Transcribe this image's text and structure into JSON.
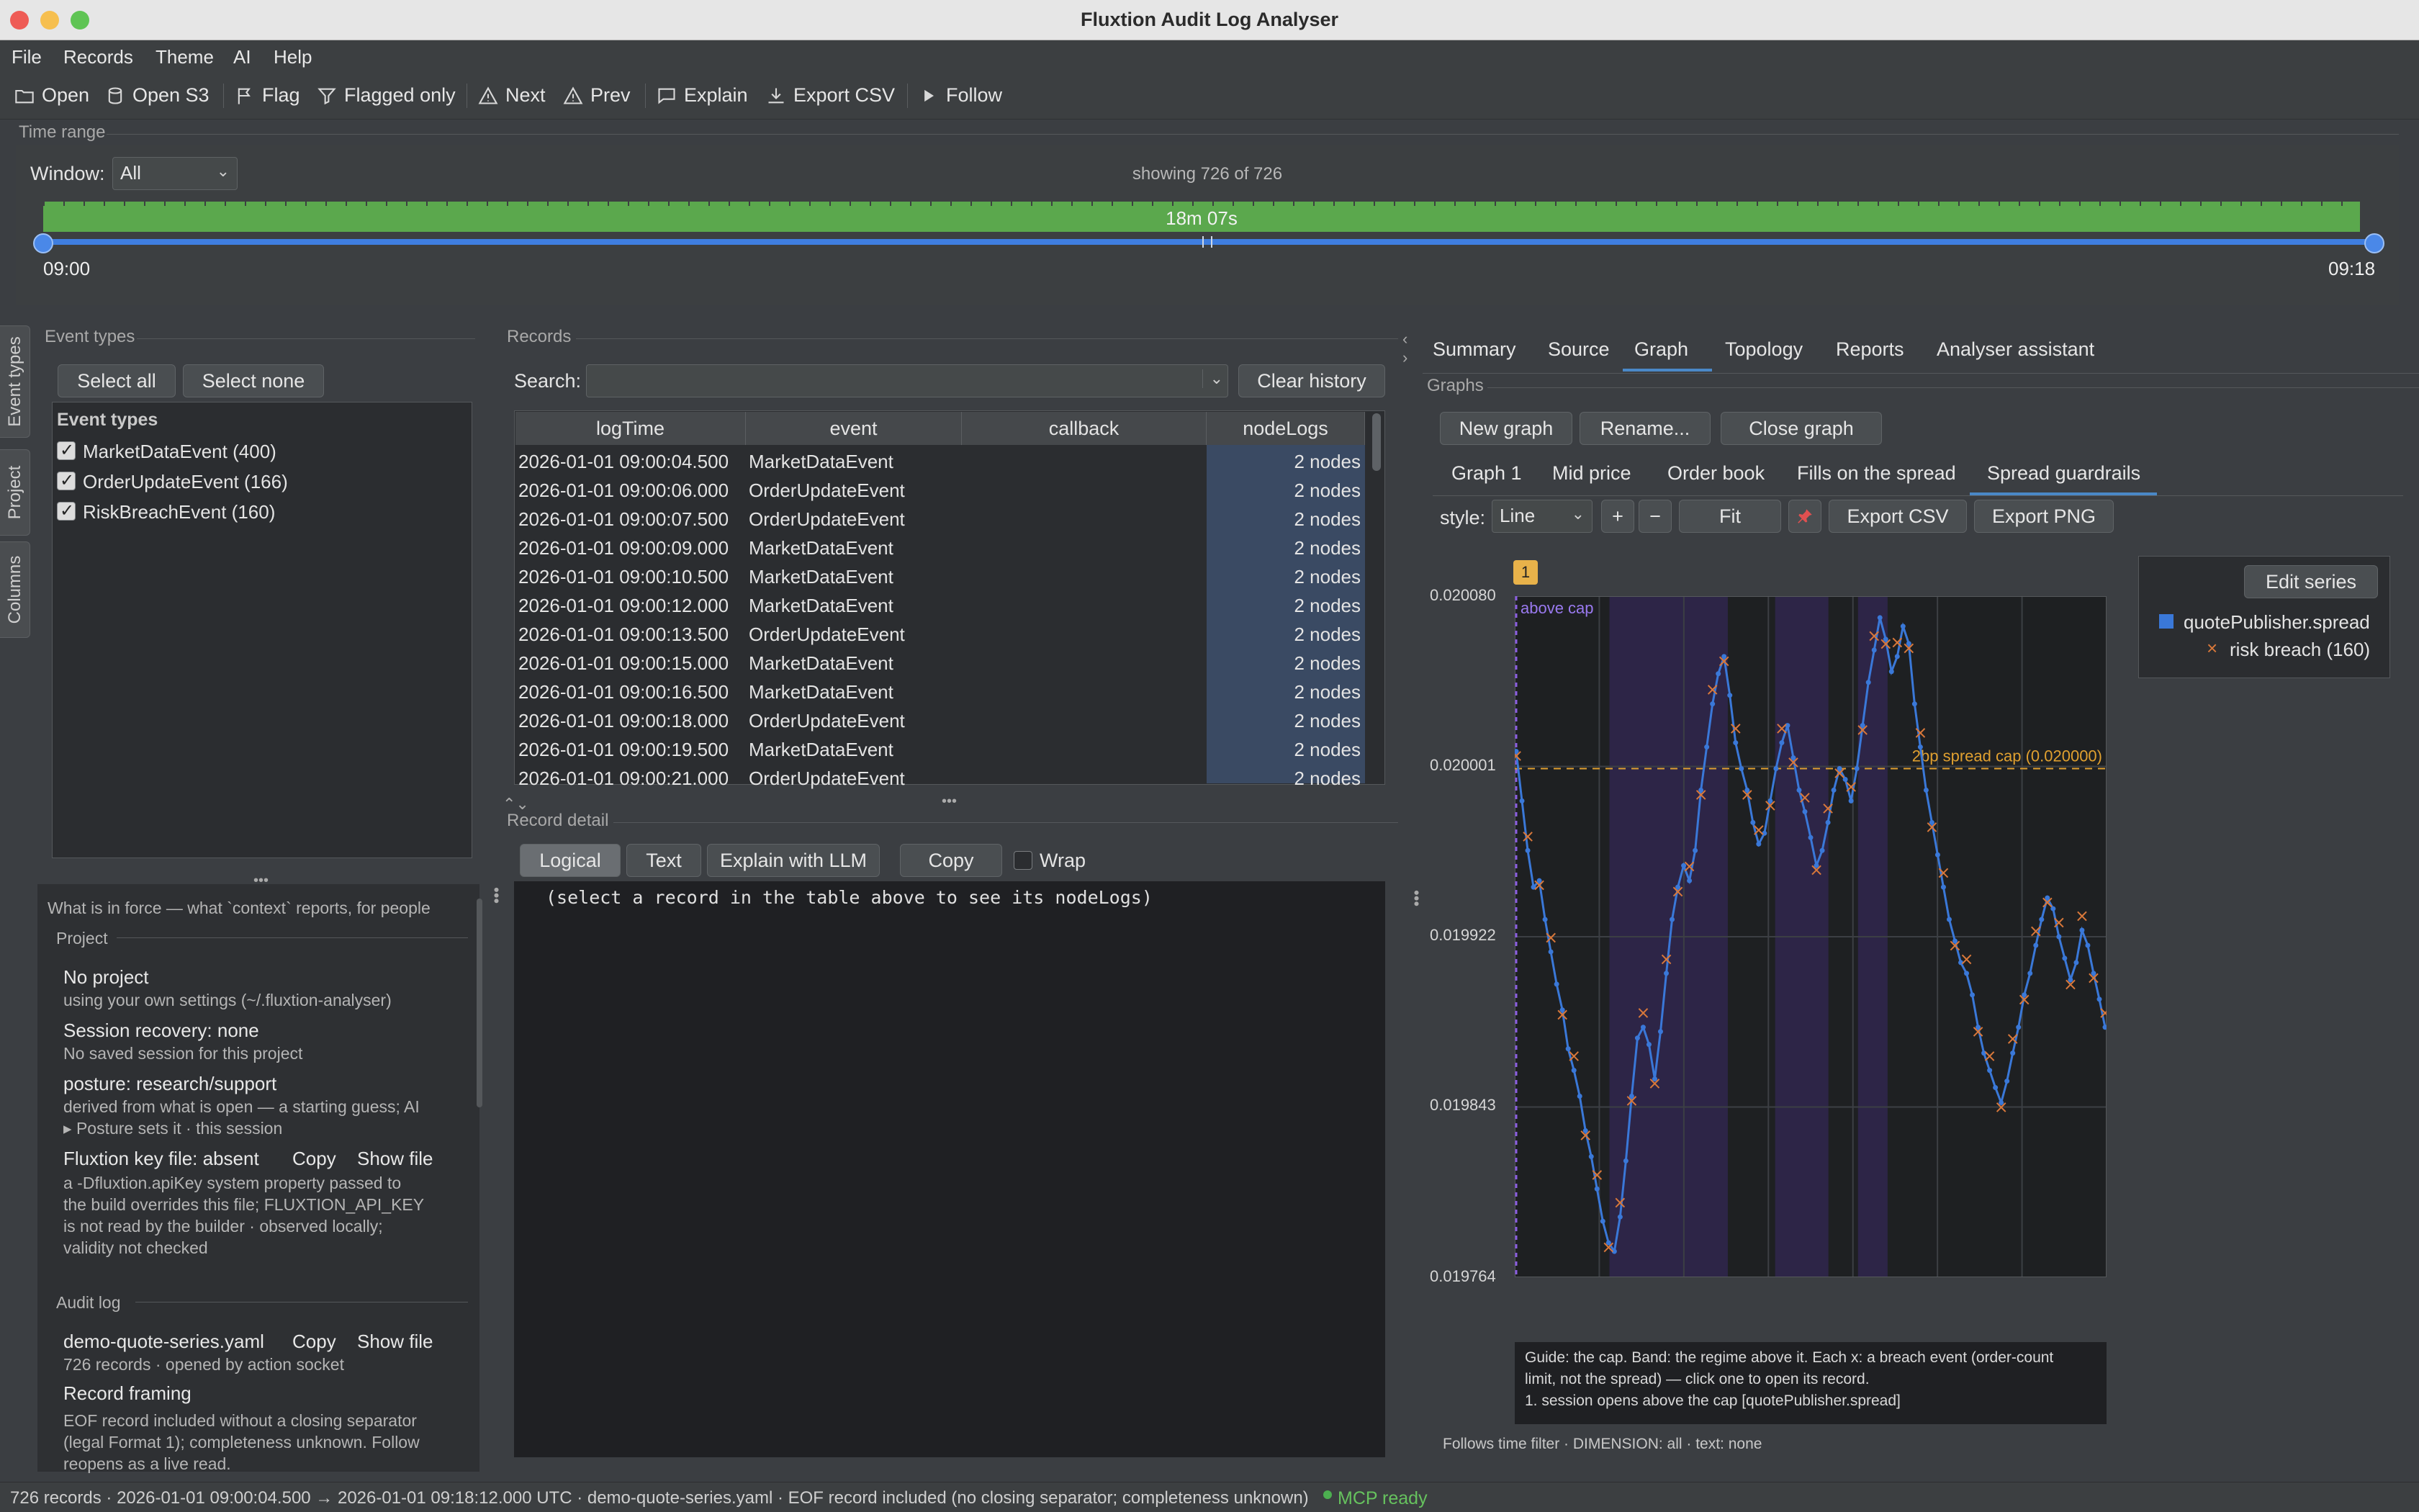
{
  "window": {
    "title": "Fluxtion Audit Log Analyser"
  },
  "menu": [
    "File",
    "Records",
    "Theme",
    "AI",
    "Help"
  ],
  "toolbar": {
    "open": "Open",
    "open_s3": "Open S3",
    "flag": "Flag",
    "flagged_only": "Flagged only",
    "next": "Next",
    "prev": "Prev",
    "explain": "Explain",
    "export_csv": "Export CSV",
    "follow": "Follow"
  },
  "time_range": {
    "group_label": "Time range",
    "window_label": "Window:",
    "window_value": "All",
    "showing": "showing 726 of 726",
    "duration": "18m 07s",
    "start": "09:00",
    "end": "09:18",
    "fill_fraction": 1.0
  },
  "rail": [
    "Event types",
    "Project",
    "Columns"
  ],
  "event_types": {
    "group_label": "Event types",
    "select_all": "Select all",
    "select_none": "Select none",
    "list_title": "Event types",
    "items": [
      {
        "name": "MarketDataEvent",
        "count": "(400)",
        "checked": true
      },
      {
        "name": "OrderUpdateEvent",
        "count": "(166)",
        "checked": true
      },
      {
        "name": "RiskBreachEvent",
        "count": "(160)",
        "checked": true
      }
    ]
  },
  "context": {
    "intro": "What is in force — what `context` reports, for people",
    "project_label": "Project",
    "no_project": "No project",
    "own_settings": "using your own settings (~/.fluxtion-analyser)",
    "session_recovery": "Session recovery: none",
    "no_saved": "No saved session for this project",
    "posture": "posture: research/support",
    "posture_note": "derived from what is open — a starting guess; AI",
    "posture_sets": "Posture sets it  ·  this session",
    "key_file": "Fluxtion key file: absent",
    "copy": "Copy",
    "show_file": "Show file",
    "key_note_1": "a -Dfluxtion.apiKey system property passed to",
    "key_note_2": "the build overrides this file; FLUXTION_API_KEY",
    "key_note_3": "is not read by the builder  ·  observed locally;",
    "key_note_4": "validity not checked",
    "audit_label": "Audit log",
    "audit_file": "demo-quote-series.yaml",
    "audit_info": "726 records  ·  opened by action socket",
    "framing": "Record framing",
    "framing_1": "EOF record included without a closing separator",
    "framing_2": "(legal Format 1); completeness unknown. Follow",
    "framing_3": "reopens as a live read."
  },
  "records": {
    "group_label": "Records",
    "search_label": "Search:",
    "search_value": "",
    "clear_history": "Clear history",
    "columns": [
      "logTime",
      "event",
      "callback",
      "nodeLogs"
    ],
    "rows": [
      [
        "2026-01-01 09:00:04.500",
        "MarketDataEvent",
        "",
        "2 nodes"
      ],
      [
        "2026-01-01 09:00:06.000",
        "OrderUpdateEvent",
        "",
        "2 nodes"
      ],
      [
        "2026-01-01 09:00:07.500",
        "OrderUpdateEvent",
        "",
        "2 nodes"
      ],
      [
        "2026-01-01 09:00:09.000",
        "MarketDataEvent",
        "",
        "2 nodes"
      ],
      [
        "2026-01-01 09:00:10.500",
        "MarketDataEvent",
        "",
        "2 nodes"
      ],
      [
        "2026-01-01 09:00:12.000",
        "MarketDataEvent",
        "",
        "2 nodes"
      ],
      [
        "2026-01-01 09:00:13.500",
        "OrderUpdateEvent",
        "",
        "2 nodes"
      ],
      [
        "2026-01-01 09:00:15.000",
        "MarketDataEvent",
        "",
        "2 nodes"
      ],
      [
        "2026-01-01 09:00:16.500",
        "MarketDataEvent",
        "",
        "2 nodes"
      ],
      [
        "2026-01-01 09:00:18.000",
        "OrderUpdateEvent",
        "",
        "2 nodes"
      ],
      [
        "2026-01-01 09:00:19.500",
        "MarketDataEvent",
        "",
        "2 nodes"
      ],
      [
        "2026-01-01 09:00:21.000",
        "OrderUpdateEvent",
        "",
        "2 nodes"
      ]
    ]
  },
  "record_detail": {
    "group_label": "Record detail",
    "logical": "Logical",
    "text": "Text",
    "explain_llm": "Explain with LLM",
    "copy": "Copy",
    "wrap": "Wrap",
    "placeholder": "(select a record in the table above to see its nodeLogs)"
  },
  "right_tabs": [
    "Summary",
    "Source",
    "Graph",
    "Topology",
    "Reports",
    "Analyser assistant"
  ],
  "right_tabs_active": "Graph",
  "graphs": {
    "group_label": "Graphs",
    "new_graph": "New graph",
    "rename": "Rename...",
    "close_graph": "Close graph",
    "tabs": [
      "Graph 1",
      "Mid price",
      "Order book",
      "Fills on the spread",
      "Spread guardrails"
    ],
    "active_tab": "Spread guardrails",
    "style_label": "style:",
    "style_value": "Line",
    "plus": "+",
    "minus": "−",
    "fit": "Fit",
    "export_csv": "Export CSV",
    "export_png": "Export PNG",
    "marker_badge": "1",
    "edit_series": "Edit series",
    "guide_1": "Guide: the cap. Band: the regime above it. Each x: a breach event (order-count",
    "guide_2": "limit, not the spread) — click one to open its record.",
    "guide_3": "1. session opens above the cap  [quotePublisher.spread]",
    "follows": "Follows time filter · DIMENSION: all · text: none"
  },
  "chart_data": {
    "type": "line",
    "title": "",
    "xlabel": "",
    "ylabel": "",
    "y_ticks": [
      "0.020080",
      "0.020001",
      "0.019922",
      "0.019843",
      "0.019764"
    ],
    "ylim": [
      0.019764,
      0.02008
    ],
    "series": [
      {
        "name": "quotePublisher.spread",
        "color": "#3a78d8",
        "marker_color": "#d9783a"
      },
      {
        "name": "risk breach",
        "count": "(160)",
        "color": "#d9783a"
      }
    ],
    "cap": {
      "label": "2bp spread cap (0.020000)",
      "value": 0.02,
      "color": "#e0a030"
    },
    "band_label": "above cap",
    "x_count": 170,
    "values": [
      0.020008,
      0.019985,
      0.019962,
      0.019945,
      0.019948,
      0.01993,
      0.019915,
      0.0199,
      0.019888,
      0.01987,
      0.01986,
      0.019848,
      0.019832,
      0.01982,
      0.019805,
      0.01979,
      0.01978,
      0.019776,
      0.019792,
      0.019818,
      0.019848,
      0.019875,
      0.01988,
      0.019872,
      0.019856,
      0.019878,
      0.019905,
      0.01993,
      0.019945,
      0.019955,
      0.019948,
      0.019962,
      0.01999,
      0.02001,
      0.02003,
      0.020044,
      0.020052,
      0.020034,
      0.020012,
      0.02,
      0.01999,
      0.019975,
      0.019965,
      0.01997,
      0.019985,
      0.02,
      0.020012,
      0.02002,
      0.020005,
      0.01999,
      0.01998,
      0.019968,
      0.019955,
      0.019962,
      0.019975,
      0.01999,
      0.02,
      0.019995,
      0.019985,
      0.02,
      0.02002,
      0.02004,
      0.020055,
      0.02007,
      0.02006,
      0.020045,
      0.020052,
      0.020066,
      0.020058,
      0.02003,
      0.02001,
      0.01999,
      0.019975,
      0.01996,
      0.019945,
      0.01993,
      0.01992,
      0.01991,
      0.019905,
      0.019895,
      0.01988,
      0.019868,
      0.01986,
      0.019852,
      0.019845,
      0.019855,
      0.019868,
      0.01988,
      0.019895,
      0.019905,
      0.019918,
      0.01993,
      0.01994,
      0.019935,
      0.019922,
      0.019912,
      0.019902,
      0.01991,
      0.019925,
      0.019918,
      0.019905,
      0.019893,
      0.01988
    ],
    "breach_marker_every": 1,
    "regime_bands": [
      [
        0.16,
        0.36
      ],
      [
        0.44,
        0.53
      ],
      [
        0.58,
        0.63
      ]
    ]
  },
  "status": {
    "text": "726 records · 2026-01-01 09:00:04.500 → 2026-01-01 09:18:12.000 UTC · demo-quote-series.yaml · EOF record included (no closing separator; completeness unknown)",
    "mcp": "MCP ready",
    "mcp_color": "#4caf50"
  }
}
